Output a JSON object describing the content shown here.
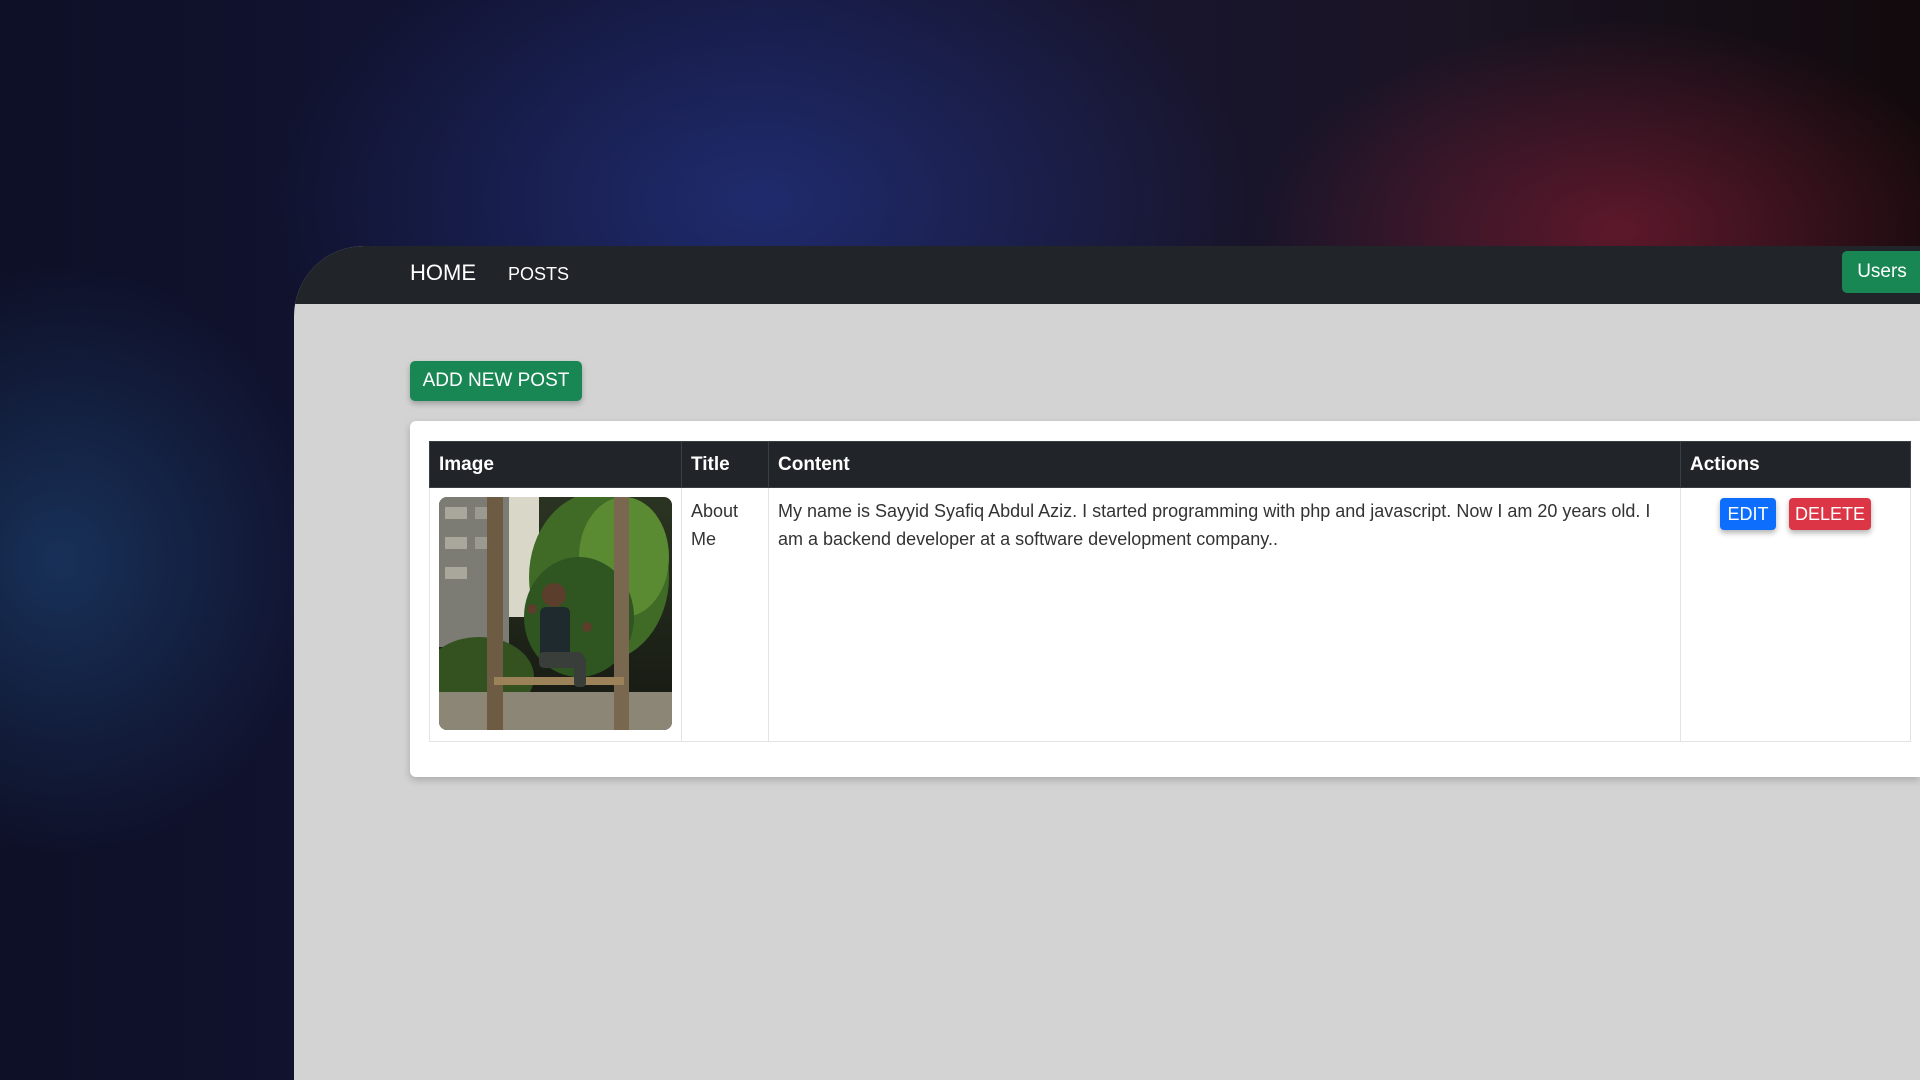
{
  "navbar": {
    "home_label": "HOME",
    "posts_label": "POSTS",
    "users_label": "Users"
  },
  "toolbar": {
    "add_label": "ADD NEW POST"
  },
  "table": {
    "headers": [
      "Image",
      "Title",
      "Content",
      "Actions"
    ],
    "rows": [
      {
        "image_alt": "Photo of a person sitting on a wooden swing among plants at night",
        "title": "About Me",
        "content": "My name is Sayyid Syafiq Abdul Aziz. I started programming with php and javascript. Now I am 20 years old. I am a backend developer at a software development company..",
        "edit_label": "EDIT",
        "delete_label": "DELETE"
      }
    ]
  },
  "colors": {
    "navbar": "#212529",
    "success": "#198754",
    "primary": "#0d6efd",
    "danger": "#dc3545",
    "page_background": "#d3d3d3"
  }
}
